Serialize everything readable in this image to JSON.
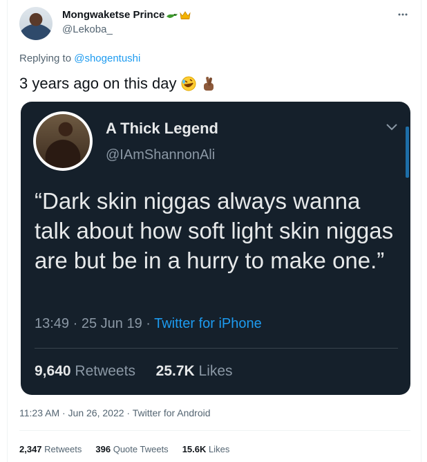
{
  "author": {
    "name": "Mongwaketse Prince",
    "handle": "@Lekoba_"
  },
  "reply": {
    "prefix": "Replying to",
    "mention": "@shogentushi"
  },
  "tweet": {
    "text": "3 years ago on this day"
  },
  "quoted": {
    "name": "A Thick Legend",
    "handle": "@IAmShannonAli",
    "text": "“Dark skin niggas always wanna talk about how soft light skin niggas are but be in a hurry to make one.”",
    "time": "13:49",
    "date": "25 Jun 19",
    "source": "Twitter for iPhone",
    "retweets_count": "9,640",
    "retweets_label": "Retweets",
    "likes_count": "25.7K",
    "likes_label": "Likes"
  },
  "footer": {
    "timestamp": "11:23 AM · Jun 26, 2022 · Twitter for Android",
    "retweets_count": "2,347",
    "retweets_label": "Retweets",
    "quotes_count": "396",
    "quotes_label": "Quote Tweets",
    "likes_count": "15.6K",
    "likes_label": "Likes"
  },
  "icons": [
    "more-icon",
    "alligator-emoji-icon",
    "crown-emoji-icon",
    "rolling-laughing-emoji-icon",
    "crossed-fingers-emoji-icon",
    "chevron-down-icon"
  ],
  "colors": {
    "accent": "#1d9bf0",
    "dark_bg": "#15202b",
    "muted": "#536471"
  }
}
